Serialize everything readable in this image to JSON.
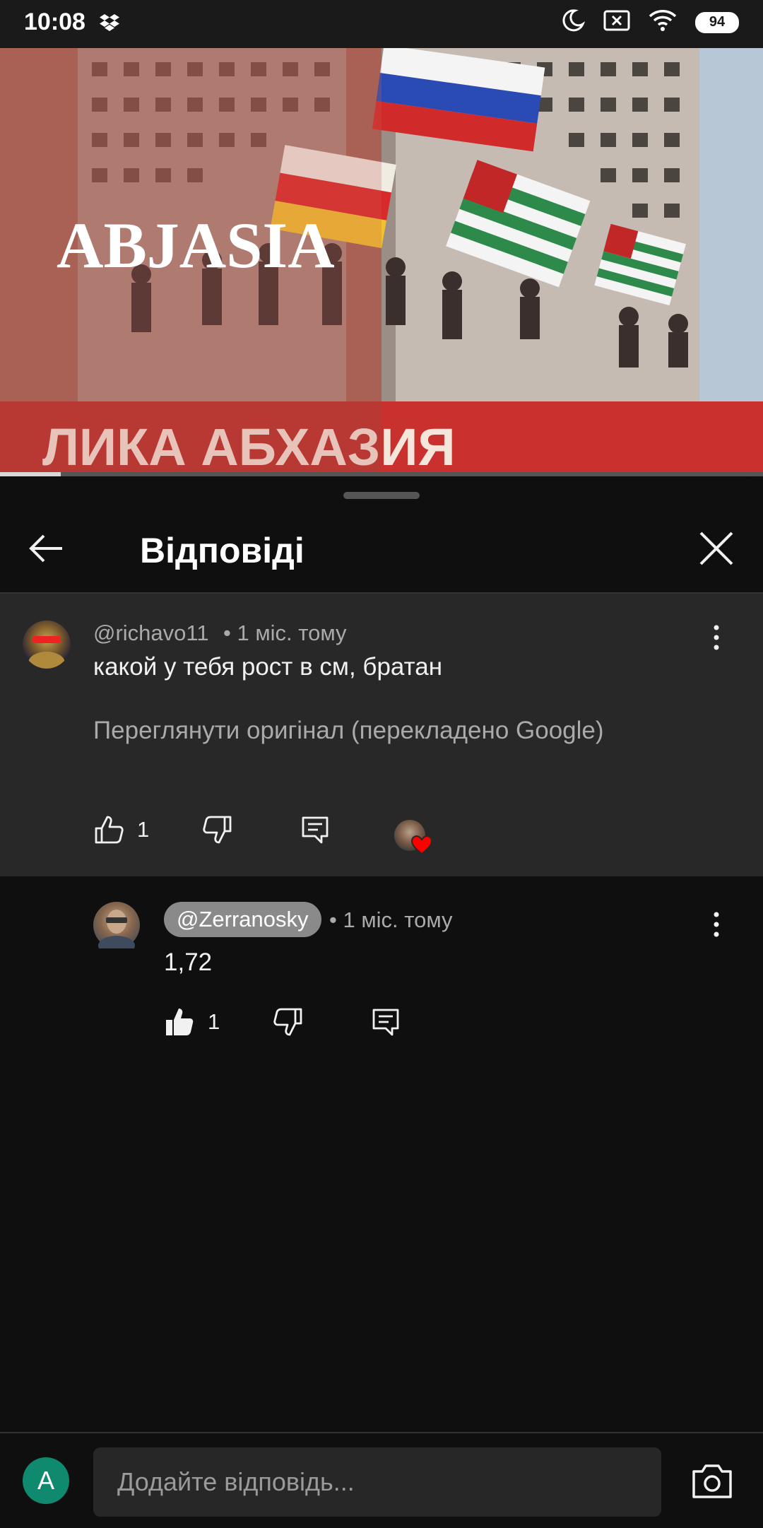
{
  "status_bar": {
    "time": "10:08",
    "battery_level": "94",
    "icons": [
      "dropbox-icon",
      "moon-icon",
      "no-sim-icon",
      "wifi-icon",
      "battery-icon"
    ]
  },
  "video": {
    "overlay_title": "ABJASIA",
    "banner_text": "ЛИКА АБХАЗИЯ",
    "progress_fraction": 0.08
  },
  "sheet": {
    "title": "Відповіді",
    "back_icon": "back-arrow-icon",
    "close_icon": "close-icon"
  },
  "parent_comment": {
    "author": "@richavo11",
    "time": "• 1 міс. тому",
    "text": "какой у тебя рост в см, братан",
    "translate_link": "Переглянути оригінал (перекладено Google)",
    "likes": "1",
    "creator_heart": true
  },
  "reply": {
    "author": "@Zerranosky",
    "time": "• 1 міс. тому",
    "text": "1,72",
    "likes": "1",
    "liked": true
  },
  "input": {
    "avatar_letter": "A",
    "placeholder": "Додайте відповідь..."
  },
  "colors": {
    "background": "#0f0f0f",
    "parent_highlight": "#282828",
    "secondary_text": "#aaaaaa",
    "avatar_accent": "#0f8a6e",
    "heart": "#ff0000"
  }
}
